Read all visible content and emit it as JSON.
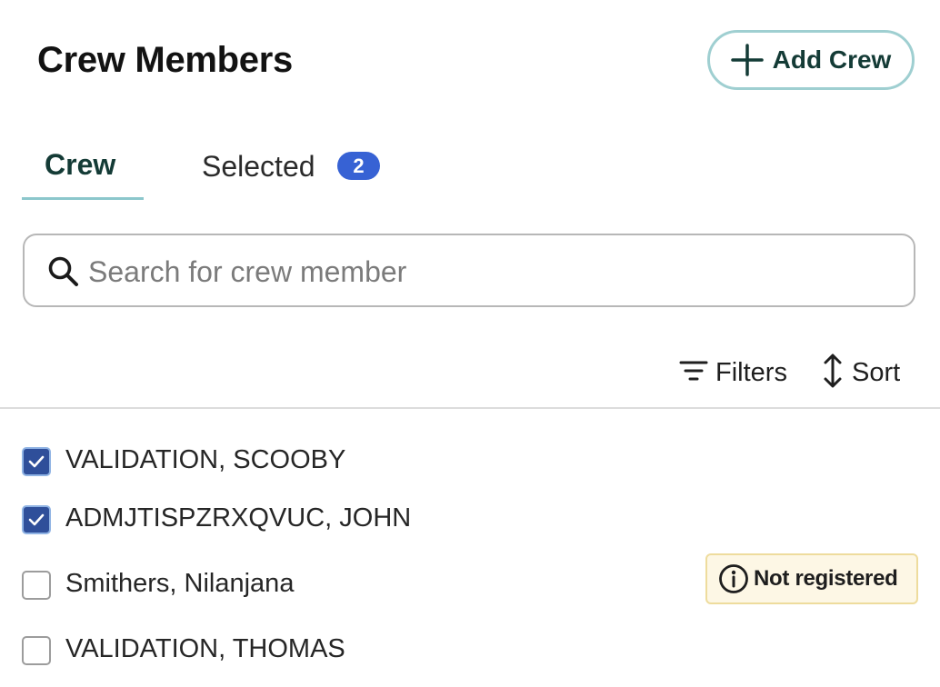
{
  "header": {
    "title": "Crew Members",
    "add_button_label": "Add Crew"
  },
  "tabs": [
    {
      "label": "Crew",
      "active": true
    },
    {
      "label": "Selected",
      "badge": "2",
      "active": false
    }
  ],
  "search": {
    "placeholder": "Search for crew member",
    "value": ""
  },
  "toolbar": {
    "filters_label": "Filters",
    "sort_label": "Sort"
  },
  "crew_list": [
    {
      "name": "VALIDATION, SCOOBY",
      "checked": true
    },
    {
      "name": "ADMJTISPZRXQVUC, JOHN",
      "checked": true
    },
    {
      "name": "Smithers, Nilanjana",
      "checked": false,
      "badge": "Not registered"
    },
    {
      "name": "VALIDATION, THOMAS",
      "checked": false
    }
  ],
  "colors": {
    "accent_teal": "#8cc7cc",
    "checkbox_blue": "#2f4f9a",
    "count_badge_blue": "#3762d4",
    "warning_bg": "#fdf7e5",
    "warning_border": "#eedc9d"
  },
  "icons": {
    "add": "plus-icon",
    "search": "search-icon",
    "filters": "filter-icon",
    "sort": "sort-arrows-icon",
    "checkbox": "checkmark-icon",
    "badge": "info-icon"
  }
}
